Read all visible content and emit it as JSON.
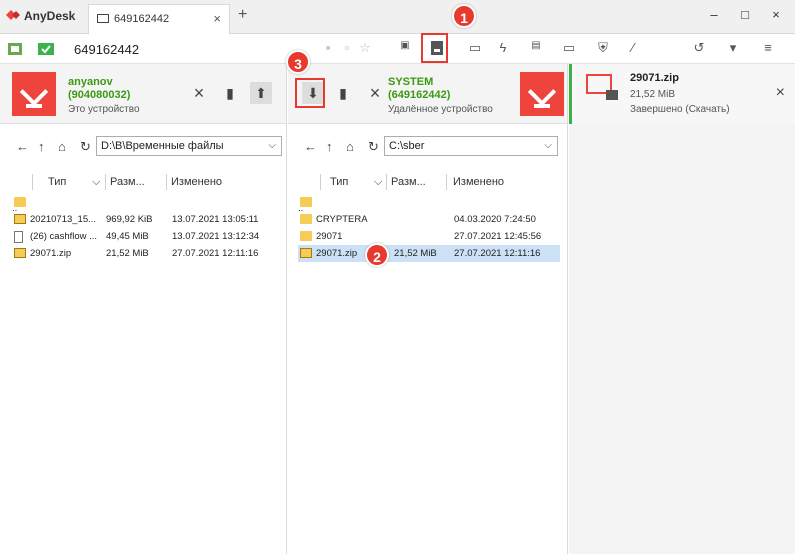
{
  "window": {
    "app_name": "AnyDesk",
    "tab_label": "649162442",
    "tab_close": "×",
    "new_tab": "+",
    "minimize": "–",
    "maximize": "□",
    "close": "×"
  },
  "addressbar": {
    "address": "649162442"
  },
  "left_panel": {
    "user_name": "anyanov",
    "user_id": "(904080032)",
    "subtitle": "Это устройство",
    "path": "D:\\B\\Временные файлы",
    "columns": [
      "Тип",
      "Разм...",
      "Изменено"
    ],
    "files": [
      {
        "name": "..",
        "size": "",
        "modified": "",
        "icon": "folder"
      },
      {
        "name": "20210713_15...",
        "size": "969,92 KiB",
        "modified": "13.07.2021 13:05:11",
        "icon": "zip"
      },
      {
        "name": "(26) cashflow ...",
        "size": "49,45 MiB",
        "modified": "13.07.2021 13:12:34",
        "icon": "doc"
      },
      {
        "name": "29071.zip",
        "size": "21,52 MiB",
        "modified": "27.07.2021 12:11:16",
        "icon": "zip"
      }
    ]
  },
  "right_panel": {
    "user_name": "SYSTEM",
    "user_id": "(649162442)",
    "subtitle": "Удалённое устройство",
    "path": "C:\\sber",
    "columns": [
      "Тип",
      "Разм...",
      "Изменено"
    ],
    "files": [
      {
        "name": "..",
        "size": "",
        "modified": "",
        "icon": "folder"
      },
      {
        "name": "CRYPTERA",
        "size": "",
        "modified": "04.03.2020 7:24:50",
        "icon": "folder"
      },
      {
        "name": "29071",
        "size": "",
        "modified": "27.07.2021 12:45:56",
        "icon": "folder"
      },
      {
        "name": "29071.zip",
        "size": "21,52 MiB",
        "modified": "27.07.2021 12:11:16",
        "icon": "zip",
        "selected": true
      }
    ]
  },
  "transfer": {
    "file_name": "29071.zip",
    "size": "21,52 MiB",
    "status": "Завершено (Скачать)",
    "close": "×"
  },
  "markers": [
    "1",
    "2",
    "3"
  ],
  "colors": {
    "accent_red": "#ef443b",
    "user_green": "#3a9a12",
    "progress_green": "#3cb34a",
    "selection": "#cce1f5"
  }
}
